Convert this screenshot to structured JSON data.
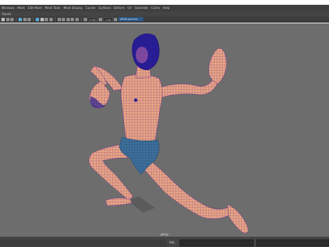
{
  "menu": [
    "Windows",
    "Mesh",
    "Edit Mesh",
    "Mesh Tools",
    "Mesh Display",
    "Curves",
    "Surfaces",
    "Deform",
    "UV",
    "Generate",
    "Cache",
    "Help"
  ],
  "panel_menu": [
    "Panels"
  ],
  "toolbar": {
    "value_a": "0.00",
    "value_b": "1.00",
    "color_space": "sRGB gamma"
  },
  "viewport": {
    "camera_label": "persp",
    "background": "#6d6d6d",
    "skin_color": "#e8a582",
    "wire_color": "#6a2f90",
    "shorts_color": "#3d6f9a",
    "highlight_color": "#2a1f9a"
  },
  "command_line": {
    "language": "MEL",
    "input": "",
    "output": ""
  }
}
